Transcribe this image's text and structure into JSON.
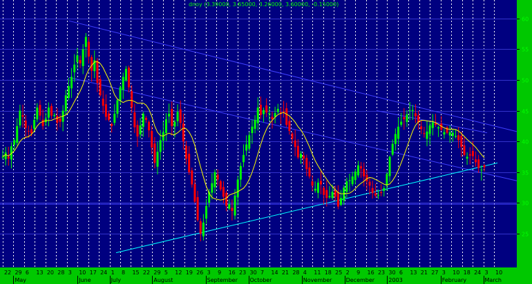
{
  "chart_data": {
    "type": "candlestick",
    "title": "dnoy (3.39000, 3.65000, 3.26000, 3.60000, -0.15000)",
    "ylim": [
      19.5,
      63
    ],
    "y_ticks": [
      25,
      30,
      35,
      40,
      45,
      50,
      55,
      60
    ],
    "grid": "on",
    "colors": {
      "background": "#000080",
      "up": "#00ff00",
      "down": "#ff0000",
      "grid": "#ffffff",
      "axis_text": "#00ff00",
      "moving_average": "#ffff00",
      "trendline": "#00ffff",
      "channel": "#4040ff",
      "axis_panel": "#00c800"
    },
    "day_labels": [
      "22",
      "29",
      "6",
      "13",
      "20",
      "28",
      "3",
      "10",
      "17",
      "24",
      "1",
      "8",
      "15",
      "22",
      "29",
      "5",
      "12",
      "19",
      "26",
      "3",
      "9",
      "16",
      "23",
      "30",
      "7",
      "14",
      "21",
      "28",
      "4",
      "11",
      "18",
      "25",
      "2",
      "9",
      "16",
      "23",
      "30",
      "6",
      "13",
      "21",
      "27",
      "3",
      "10",
      "18",
      "24",
      "3",
      "10"
    ],
    "month_labels": [
      "May",
      "June",
      "July",
      "August",
      "September",
      "October",
      "November",
      "December",
      "2003",
      "February",
      "March"
    ],
    "closes": [
      37.5,
      38.2,
      37.2,
      39.2,
      40.2,
      42.5,
      45.0,
      44.0,
      42.2,
      41.7,
      41.3,
      43.5,
      45.5,
      44.2,
      42.5,
      43.7,
      45.5,
      44.2,
      44.3,
      43.0,
      43.2,
      45.0,
      47.5,
      49.0,
      50.5,
      52.5,
      54.0,
      52.7,
      55.0,
      57.0,
      53.8,
      51.5,
      53.2,
      49.5,
      47.5,
      45.8,
      44.0,
      43.5,
      42.5,
      44.5,
      46.7,
      48.8,
      50.5,
      51.8,
      48.8,
      45.5,
      42.3,
      40.8,
      42.6,
      44.5,
      43.5,
      41.8,
      39.0,
      36.5,
      38.3,
      40.2,
      41.5,
      43.6,
      44.5,
      42.5,
      43.2,
      44.8,
      43.0,
      40.0,
      37.2,
      35.0,
      33.0,
      30.2,
      27.2,
      25.0,
      26.8,
      29.5,
      31.8,
      33.2,
      35.0,
      33.8,
      32.2,
      31.0,
      29.5,
      29.8,
      28.7,
      31.2,
      33.8,
      36.0,
      37.8,
      39.5,
      41.0,
      42.4,
      43.5,
      45.5,
      44.3,
      45.1,
      44.7,
      44.6,
      43.6,
      44.6,
      45.3,
      44.5,
      44.8,
      42.7,
      41.7,
      40.4,
      39.1,
      37.4,
      38.0,
      37.2,
      35.5,
      34.3,
      32.8,
      32.3,
      33.3,
      33.0,
      31.3,
      30.8,
      31.1,
      31.8,
      31.0,
      29.4,
      30.8,
      32.5,
      33.5,
      33.7,
      34.3,
      35.1,
      36.1,
      35.6,
      34.3,
      33.5,
      32.8,
      31.6,
      31.2,
      31.3,
      31.6,
      32.4,
      34.7,
      37.5,
      39.6,
      41.2,
      42.4,
      43.2,
      43.6,
      44.4,
      45.1,
      45.1,
      44.1,
      43.1,
      42.0,
      41.2,
      41.6,
      42.6,
      43.1,
      42.7,
      42.3,
      41.9,
      41.5,
      41.4,
      41.5,
      41.4,
      40.9,
      40.2,
      39.1,
      37.8,
      37.5,
      37.7,
      37.6,
      36.6,
      35.7,
      35.4,
      35.8
    ]
  }
}
